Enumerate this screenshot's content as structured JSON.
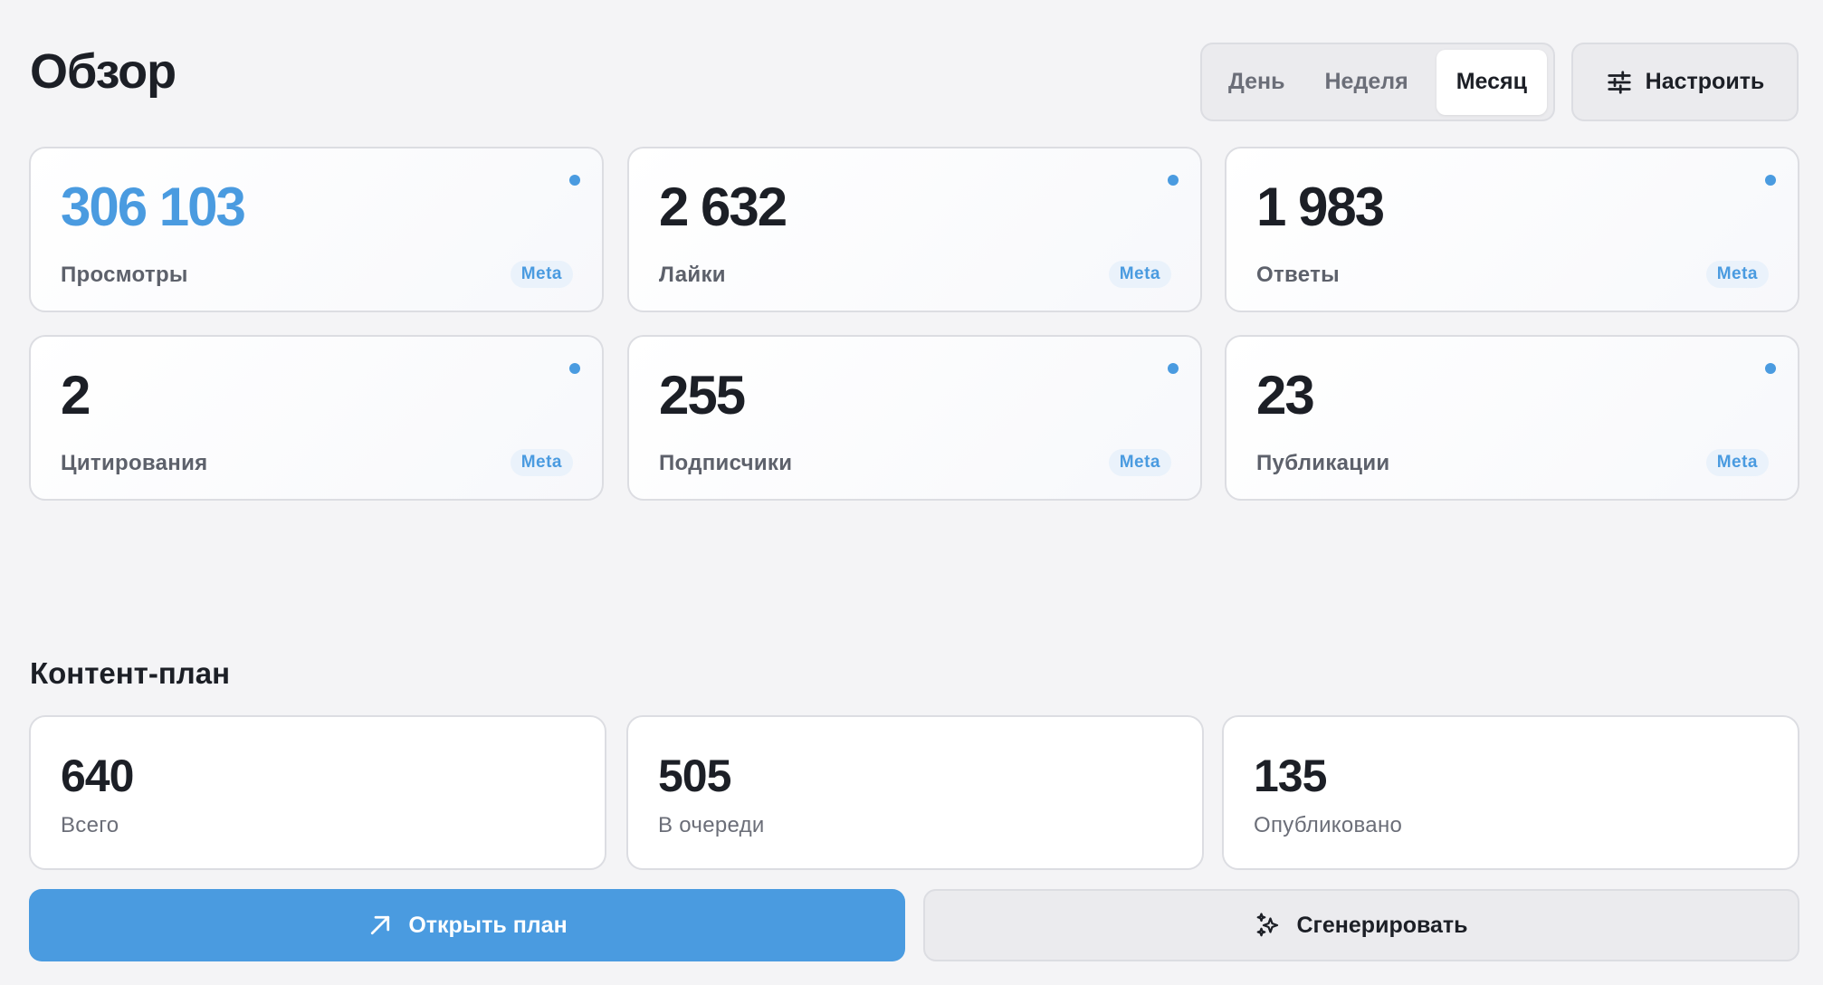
{
  "header": {
    "title": "Обзор",
    "periods": [
      "День",
      "Неделя",
      "Месяц"
    ],
    "active_period": "Месяц",
    "configure_label": "Настроить",
    "configure_icon": "sliders-icon"
  },
  "stats": [
    {
      "value": "306 103",
      "label": "Просмотры",
      "source": "Meta",
      "accent": true
    },
    {
      "value": "2 632",
      "label": "Лайки",
      "source": "Meta",
      "accent": false
    },
    {
      "value": "1 983",
      "label": "Ответы",
      "source": "Meta",
      "accent": false
    },
    {
      "value": "2",
      "label": "Цитирования",
      "source": "Meta",
      "accent": false
    },
    {
      "value": "255",
      "label": "Подписчики",
      "source": "Meta",
      "accent": false
    },
    {
      "value": "23",
      "label": "Публикации",
      "source": "Meta",
      "accent": false
    }
  ],
  "content_plan": {
    "title": "Контент-план",
    "cards": [
      {
        "value": "640",
        "label": "Всего"
      },
      {
        "value": "505",
        "label": "В очереди"
      },
      {
        "value": "135",
        "label": "Опубликовано"
      }
    ],
    "open_label": "Открыть план",
    "open_icon": "arrow-up-right-icon",
    "generate_label": "Сгенерировать",
    "generate_icon": "sparkles-icon"
  },
  "colors": {
    "accent": "#4a9be0",
    "background": "#f4f4f6",
    "text": "#1c1f26",
    "muted": "#6b6e78"
  }
}
